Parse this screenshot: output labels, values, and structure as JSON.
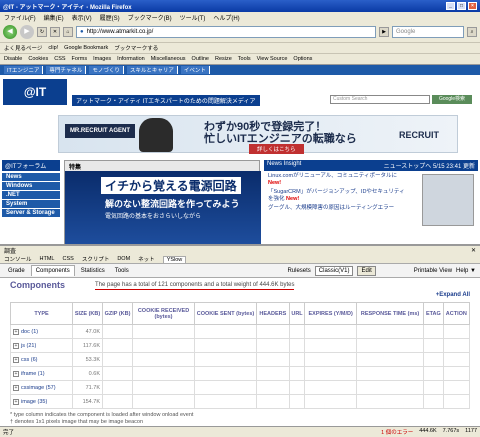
{
  "window": {
    "title": "@IT - アットマーク・アイティ - Mozilla Firefox"
  },
  "menu": [
    "ファイル(F)",
    "編集(E)",
    "表示(V)",
    "履歴(S)",
    "ブックマーク(B)",
    "ツール(T)",
    "ヘルプ(H)"
  ],
  "nav": {
    "url": "http://www.atmarkit.co.jp/",
    "search_placeholder": "Google"
  },
  "bookmarks": [
    "よく見るページ",
    "clip!",
    "Google Bookmark",
    "ブックマークする"
  ],
  "devbar": [
    "Disable",
    "Cookies",
    "CSS",
    "Forms",
    "Images",
    "Information",
    "Miscellaneous",
    "Outline",
    "Resize",
    "Tools",
    "View Source",
    "Options"
  ],
  "site": {
    "top_links": [
      "ITエンジニア",
      "専門チャネル",
      "モノづくり",
      "スキルとキャリア",
      "イベント"
    ],
    "logo": "@IT",
    "tagline": "アットマーク・アイティ ITエキスパートのための問題解決メディア",
    "search_placeholder": "Custom Search",
    "search_button": "Google検索",
    "banner": {
      "agent": "MR.RECRUIT AGENT",
      "copy1": "わずか90秒で登録完了！",
      "copy2": "忙しいITエンジニアの転職なら",
      "detail": "詳しくはこちら",
      "brand": "RECRUIT AGENT"
    },
    "left_header": "@ITフォーラム",
    "left_items": [
      "News",
      "Windows",
      ".NET",
      "System",
      "Server & Storage"
    ],
    "feature_header": "特集",
    "feature_title": "イチから覚える電源回路",
    "feature_sub": "解のない整流回路を作ってみよう",
    "feature_sub2": "電気回路の基本をおさらいしながら",
    "news_header": "News Insight",
    "news_more": "ニューストップへ 5/15 23:41 更新",
    "news_items": [
      {
        "text": "Linux.comがリニューアル、コミュニティポータルに",
        "new": "New!"
      },
      {
        "text": "「SugarCRM」がバージョンアップ、IDやセキュリティを強化",
        "new": "New!"
      },
      {
        "text": "グーグル、大規模障害の原因はルーティングエラー",
        "new": ""
      }
    ]
  },
  "firebug": {
    "title": "調査",
    "tabs": [
      "コンソール",
      "HTML",
      "CSS",
      "スクリプト",
      "DOM",
      "ネット",
      "YSlow"
    ],
    "active_tab": "YSlow"
  },
  "yslow": {
    "tabs": [
      "Grade",
      "Components",
      "Statistics",
      "Tools"
    ],
    "active_tab": "Components",
    "rulesets_label": "Rulesets",
    "ruleset_value": "Classic(V1)",
    "edit_button": "Edit",
    "printable": "Printable View",
    "help": "Help ▼",
    "title": "Components",
    "summary": "The page has a total of 121 components and a total weight of 444.6K bytes",
    "expand_all": "+Expand All",
    "columns": [
      "TYPE",
      "SIZE (KB)",
      "GZIP (KB)",
      "COOKIE RECEIVED (bytes)",
      "COOKIE SENT (bytes)",
      "HEADERS",
      "URL",
      "EXPIRES (Y/M/D)",
      "RESPONSE TIME (ms)",
      "ETAG",
      "ACTION"
    ],
    "rows": [
      {
        "type": "doc (1)",
        "size": "47.0K"
      },
      {
        "type": "js (21)",
        "size": "117.6K"
      },
      {
        "type": "css (6)",
        "size": "53.3K"
      },
      {
        "type": "iframe (1)",
        "size": "0.6K"
      },
      {
        "type": "cssimage (57)",
        "size": "71.7K"
      },
      {
        "type": "image (35)",
        "size": "154.7K"
      }
    ],
    "notes": [
      "* type column indicates the component is loaded after window onload event",
      "† denotes 1x1 pixels image that may be image beacon"
    ]
  },
  "status": {
    "left": "完了",
    "errors": "1 個のエラー",
    "size": "444.6K",
    "time": "7.767s",
    "counter": "1177"
  }
}
